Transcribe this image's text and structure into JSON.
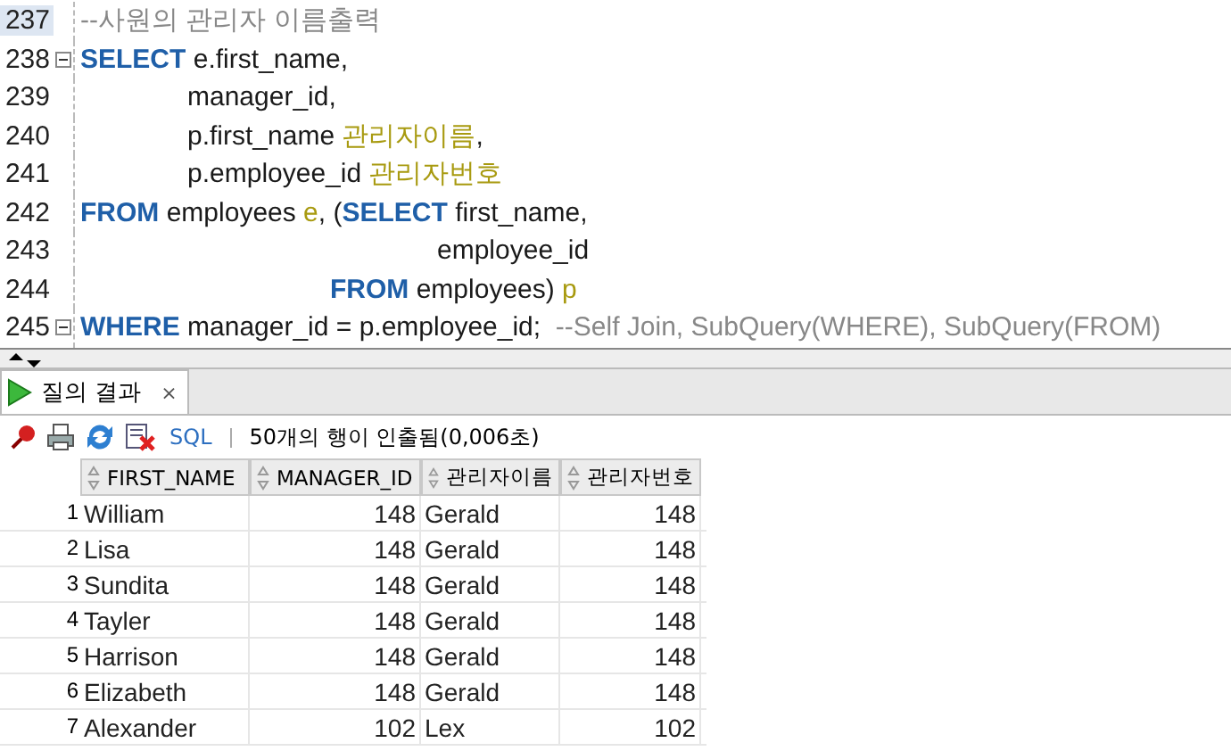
{
  "editor": {
    "lines": [
      {
        "number": "237",
        "fold": false,
        "current": true,
        "kind": "statement",
        "segments": [
          {
            "kind": "comment",
            "text": "--사원의 관리자 이름출력"
          }
        ]
      },
      {
        "number": "238",
        "fold": true,
        "current": false,
        "kind": "statement",
        "segments": [
          {
            "kind": "keyword",
            "text": "SELECT"
          },
          {
            "kind": "plain",
            "text": " e.first_name,"
          }
        ]
      },
      {
        "number": "239",
        "fold": false,
        "current": false,
        "kind": "list",
        "segments": [
          {
            "kind": "plain",
            "text": "manager_id,"
          }
        ]
      },
      {
        "number": "240",
        "fold": false,
        "current": false,
        "kind": "list",
        "segments": [
          {
            "kind": "plain",
            "text": "p.first_name "
          },
          {
            "kind": "alias",
            "text": "관리자이름"
          },
          {
            "kind": "plain",
            "text": ","
          }
        ]
      },
      {
        "number": "241",
        "fold": false,
        "current": false,
        "kind": "list",
        "segments": [
          {
            "kind": "plain",
            "text": "p.employee_id "
          },
          {
            "kind": "alias",
            "text": "관리자번호"
          }
        ]
      },
      {
        "number": "242",
        "fold": false,
        "current": false,
        "kind": "statement",
        "segments": [
          {
            "kind": "keyword",
            "text": "FROM"
          },
          {
            "kind": "plain",
            "text": " employees "
          },
          {
            "kind": "alias",
            "text": "e"
          },
          {
            "kind": "plain",
            "text": ", ("
          },
          {
            "kind": "keyword",
            "text": "SELECT"
          },
          {
            "kind": "plain",
            "text": " first_name,"
          }
        ]
      },
      {
        "number": "243",
        "fold": false,
        "current": false,
        "kind": "subquery_list",
        "segments": [
          {
            "kind": "plain",
            "text": "employee_id"
          }
        ]
      },
      {
        "number": "244",
        "fold": false,
        "current": false,
        "kind": "subquery",
        "segments": [
          {
            "kind": "keyword",
            "text": "FROM"
          },
          {
            "kind": "plain",
            "text": " employees) "
          },
          {
            "kind": "alias",
            "text": "p"
          }
        ]
      },
      {
        "number": "245",
        "fold": true,
        "current": false,
        "kind": "statement",
        "segments": [
          {
            "kind": "keyword",
            "text": "WHERE"
          },
          {
            "kind": "plain",
            "text": " manager_id = p.employee_id;  "
          },
          {
            "kind": "comment",
            "text": "--Self Join, SubQuery(WHERE), SubQuery(FROM)"
          }
        ]
      }
    ]
  },
  "tabs": [
    {
      "label": "질의 결과",
      "close": "×",
      "selected": true
    }
  ],
  "toolbar": {
    "sql_label": "SQL",
    "status": "50개의 행이 인출됨(0,006초)"
  },
  "table": {
    "columns": [
      {
        "label": "FIRST_NAME",
        "kind": "text"
      },
      {
        "label": "MANAGER_ID",
        "kind": "number"
      },
      {
        "label": "관리자이름",
        "kind": "text"
      },
      {
        "label": "관리자번호",
        "kind": "number"
      }
    ],
    "rows": [
      {
        "number": "1",
        "cells": [
          "William",
          "148",
          "Gerald",
          "148"
        ]
      },
      {
        "number": "2",
        "cells": [
          "Lisa",
          "148",
          "Gerald",
          "148"
        ]
      },
      {
        "number": "3",
        "cells": [
          "Sundita",
          "148",
          "Gerald",
          "148"
        ]
      },
      {
        "number": "4",
        "cells": [
          "Tayler",
          "148",
          "Gerald",
          "148"
        ]
      },
      {
        "number": "5",
        "cells": [
          "Harrison",
          "148",
          "Gerald",
          "148"
        ]
      },
      {
        "number": "6",
        "cells": [
          "Elizabeth",
          "148",
          "Gerald",
          "148"
        ]
      },
      {
        "number": "7",
        "cells": [
          "Alexander",
          "102",
          "Lex",
          "102"
        ]
      }
    ]
  }
}
